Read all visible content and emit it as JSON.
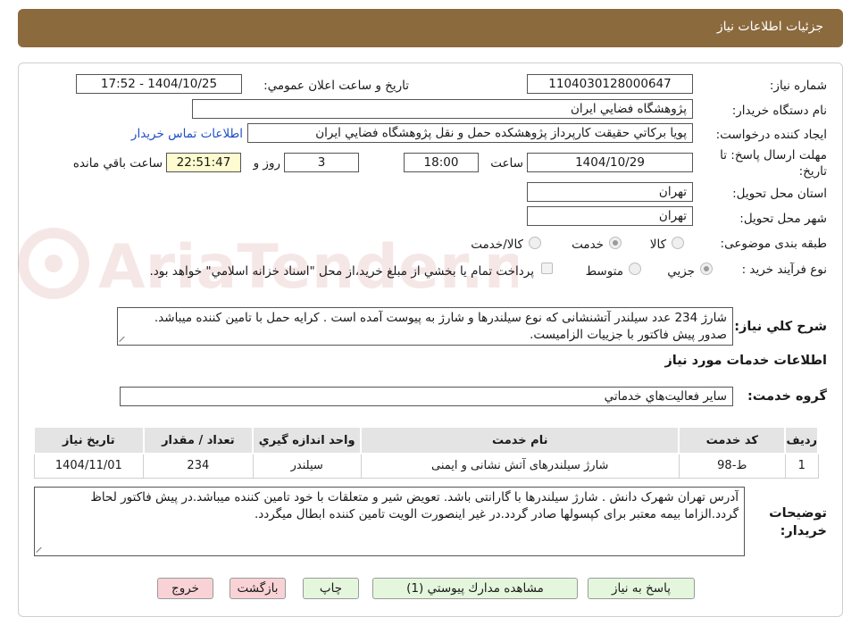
{
  "header": {
    "title": "جزئیات اطلاعات نیاز"
  },
  "watermark": {
    "text": "AriaTender.neT"
  },
  "fields": {
    "need_number_label": "شماره نیاز:",
    "need_number": "1104030128000647",
    "announce_label": "تاریخ و ساعت اعلان عمومي:",
    "announce_value": "1404/10/25 - 17:52",
    "buyer_label": "نام دستگاه خريدار:",
    "buyer_value": "پژوهشگاه فضايي ايران",
    "creator_label": "ايجاد كننده درخواست:",
    "creator_value": "پويا بركاتي حقيقت كارپرداز پژوهشكده حمل و نقل پژوهشگاه فضايي ايران",
    "contact_link": "اطلاعات تماس خريدار",
    "deadline_label_1": "مهلت ارسال پاسخ: تا",
    "deadline_label_2": "تاريخ:",
    "deadline_date": "1404/10/29",
    "hour_label": "ساعت",
    "deadline_time": "18:00",
    "days_value": "3",
    "days_label": "روز و",
    "remaining_time": "22:51:47",
    "remaining_label": "ساعت باقي مانده",
    "province_label": "استان محل تحویل:",
    "province_value": "تهران",
    "city_label": "شهر محل تحویل:",
    "city_value": "تهران",
    "category_label": "طبقه بندی موضوعی:",
    "category_options": [
      "كالا",
      "خدمت",
      "كالا/خدمت"
    ],
    "process_label": "نوع فرآيند خريد :",
    "process_options": [
      "جزيي",
      "متوسط"
    ],
    "payment_note": "پرداخت تمام يا بخشي از مبلغ خريد،از محل \"اسناد خزانه اسلامي\" خواهد بود.",
    "summary_label": "شرح كلي نياز:",
    "summary_text": "شارژ 234 عدد سیلندر آتشنشانی که نوع سیلندرها و شارژ به پیوست  آمده است . کرایه حمل با تامین کننده میباشد. صدور پیش فاکتور با جزییات الزامیست.",
    "services_title": "اطلاعات خدمات مورد نياز",
    "service_group_label": "گروه خدمت:",
    "service_group_value": "ساير فعاليت‌هاي خدماتي",
    "notes_label_1": "توضیحات",
    "notes_label_2": "خریدار:",
    "notes_text": "آدرس تهران شهرک دانش . شارژ سیلندرها با گارانتی باشد. تعویض شیر و متعلقات با خود تامین کننده میباشد.در پیش فاکتور لحاظ گردد.الزاما بیمه معتبر برای کپسولها صادر گردد.در غیر اینصورت الویت تامین کننده ابطال میگردد."
  },
  "table": {
    "headers": [
      "رديف",
      "كد خدمت",
      "نام خدمت",
      "واحد اندازه گيري",
      "تعداد / مقدار",
      "تاريخ نياز"
    ],
    "rows": [
      [
        "1",
        "ط-98",
        "شارژ سیلندرهای آتش نشانی و ایمنی",
        "سیلندر",
        "234",
        "1404/11/01"
      ]
    ]
  },
  "buttons": {
    "reply": "پاسخ به نياز",
    "attachments": "مشاهده مدارك پيوستي (1)",
    "print": "چاپ",
    "back": "بازگشت",
    "exit": "خروج"
  }
}
